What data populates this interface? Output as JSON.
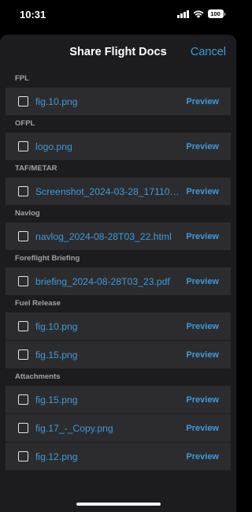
{
  "status_bar": {
    "time": "10:31",
    "battery": "100"
  },
  "sheet": {
    "title": "Share Flight Docs",
    "cancel_label": "Cancel"
  },
  "sections": [
    {
      "title": "FPL",
      "files": [
        {
          "name": "fig.10.png",
          "preview": "Preview"
        }
      ]
    },
    {
      "title": "OFPL",
      "files": [
        {
          "name": "logo.png",
          "preview": "Preview"
        }
      ]
    },
    {
      "title": "TAF/METAR",
      "files": [
        {
          "name": "Screenshot_2024-03-28_171109....",
          "preview": "Preview"
        }
      ]
    },
    {
      "title": "Navlog",
      "files": [
        {
          "name": "navlog_2024-08-28T03_22.html",
          "preview": "Preview"
        }
      ]
    },
    {
      "title": "Foreflight Briefing",
      "files": [
        {
          "name": "briefing_2024-08-28T03_23.pdf",
          "preview": "Preview"
        }
      ]
    },
    {
      "title": "Fuel Release",
      "files": [
        {
          "name": "fig.10.png",
          "preview": "Preview"
        },
        {
          "name": "fig.15.png",
          "preview": "Preview"
        }
      ]
    },
    {
      "title": "Attachments",
      "files": [
        {
          "name": "fig.15.png",
          "preview": "Preview"
        },
        {
          "name": "fig.17_-_Copy.png",
          "preview": "Preview"
        },
        {
          "name": "fig.12.png",
          "preview": "Preview"
        }
      ]
    }
  ],
  "colors": {
    "accent": "#3d9bdb",
    "sheet_bg": "#1c1c1e",
    "row_bg": "#2c2c2e",
    "section_text": "#a3a3a8"
  }
}
